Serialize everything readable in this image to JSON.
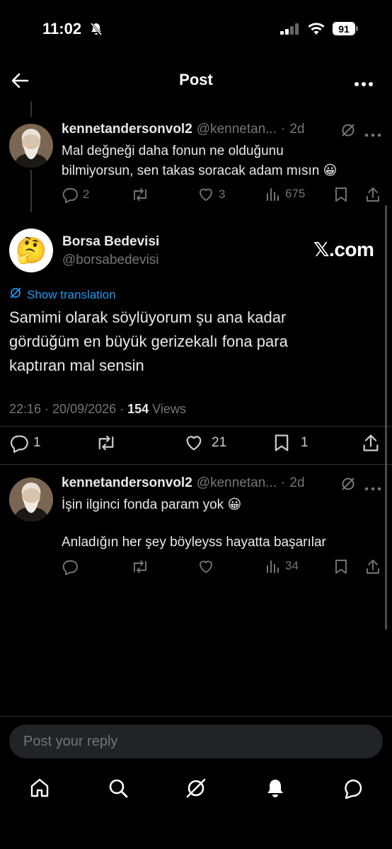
{
  "status_bar": {
    "time": "11:02",
    "battery": "91"
  },
  "header": {
    "title": "Post"
  },
  "parent_reply": {
    "name": "kennetandersonvol2",
    "handle": "@kennetan...",
    "time": "2d",
    "text_line1": "Mal değneği daha fonun ne olduğunu",
    "text_line2": "bilmiyorsun, sen takas soracak adam mısın 😀",
    "replies": "2",
    "likes": "3",
    "views": "675"
  },
  "main_post": {
    "name": "Borsa Bedevisi",
    "handle": "@borsabedevisi",
    "avatar_emoji": "🤔",
    "brand": "𝕏.com",
    "show_translation": "Show translation",
    "text_line1": "Samimi olarak söylüyorum şu ana kadar",
    "text_line2": "gördüğüm en büyük gerizekalı fona para",
    "text_line3": "kaptıran mal sensin",
    "timestamp": "22:16 · 20/09/2026 · ",
    "views_count": "154",
    "views_label": " Views",
    "replies": "1",
    "likes": "21",
    "bookmarks": "1"
  },
  "child_reply": {
    "name": "kennetandersonvol2",
    "handle": "@kennetan...",
    "time": "2d",
    "text_line1": "İşin ilginci fonda param yok 😀",
    "text_line2": "Anladığın her şey böyleyss hayatta başarılar",
    "views": "34"
  },
  "reply_input": {
    "placeholder": "Post your reply"
  },
  "colors": {
    "accent": "#1d9bf0",
    "muted": "#71767b",
    "background": "#000000"
  }
}
